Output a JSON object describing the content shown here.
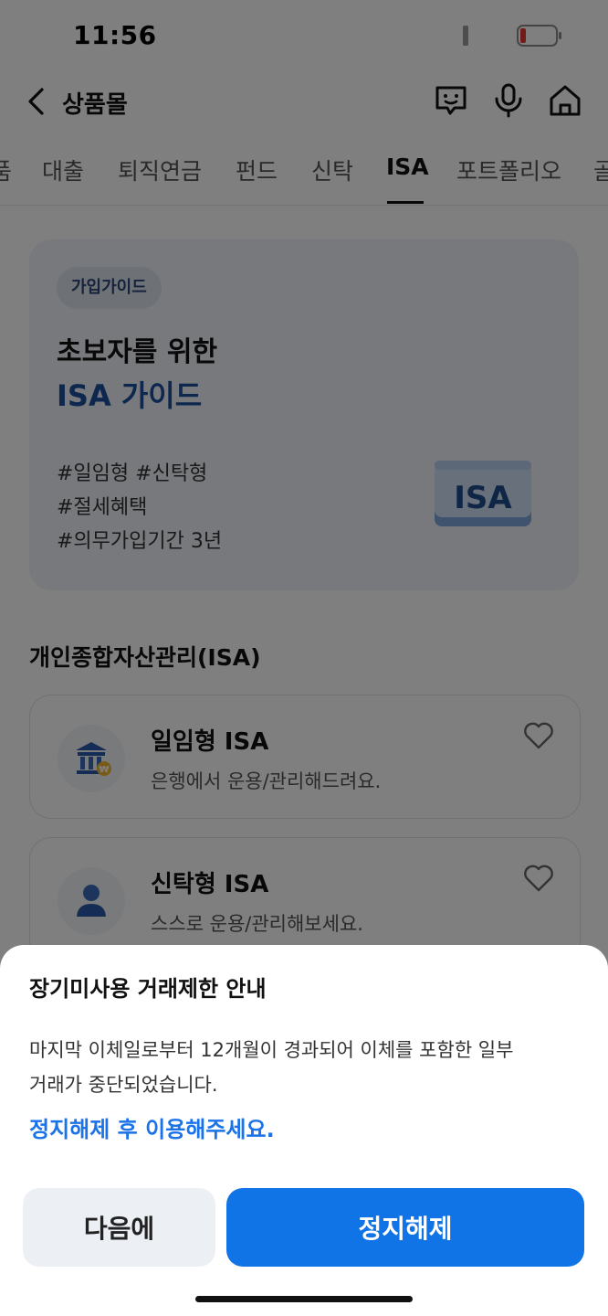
{
  "status": {
    "time": "11:56"
  },
  "header": {
    "title": "상품몰"
  },
  "tabs": [
    "품",
    "대출",
    "퇴직연금",
    "펀드",
    "신탁",
    "ISA",
    "포트폴리오",
    "골"
  ],
  "active_tab_index": 5,
  "guide": {
    "chip": "가입가이드",
    "line1": "초보자를 위한",
    "line2": "ISA 가이드",
    "hashtags": [
      "#일임형 #신탁형",
      "#절세혜택",
      "#의무가입기간 3년"
    ],
    "badge": "ISA"
  },
  "section_title": "개인종합자산관리(ISA)",
  "products": [
    {
      "name": "일임형 ISA",
      "desc": "은행에서 운용/관리해드려요.",
      "icon": "bank-won-icon"
    },
    {
      "name": "신탁형 ISA",
      "desc": "스스로 운용/관리해보세요.",
      "icon": "person-icon"
    }
  ],
  "sheet": {
    "title": "장기미사용 거래제한 안내",
    "body_line1": "마지막 이체일로부터 12개월이 경과되어 이체를 포함한 일부",
    "body_line2": "거래가 중단되었습니다.",
    "link": "정지해제 후 이용해주세요.",
    "btn_later": "다음에",
    "btn_release": "정지해제"
  },
  "colors": {
    "primary": "#1174e6",
    "link": "#1a73e8",
    "guide_accent": "#1c4f9c"
  }
}
